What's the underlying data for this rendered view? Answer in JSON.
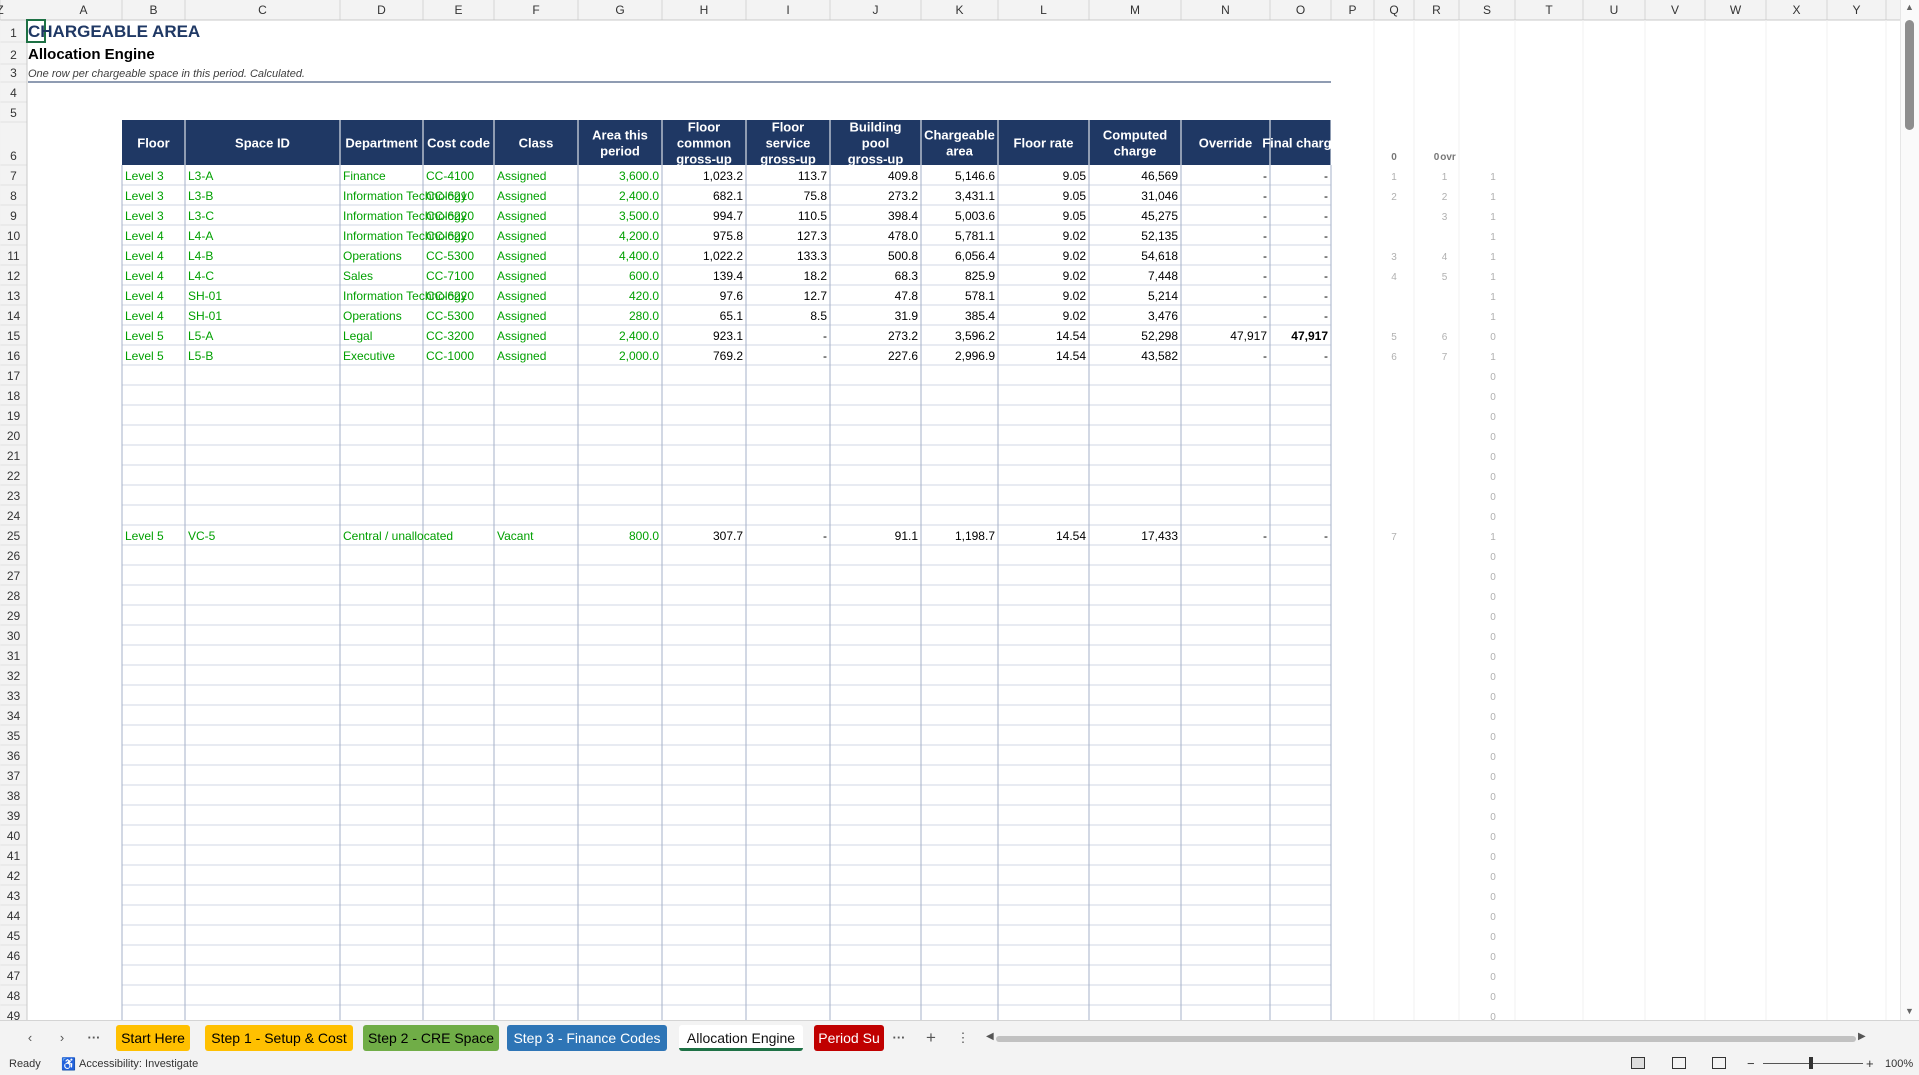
{
  "sheet": {
    "columns": [
      "A",
      "B",
      "C",
      "D",
      "E",
      "F",
      "G",
      "H",
      "I",
      "J",
      "K",
      "L",
      "M",
      "N",
      "O",
      "P",
      "Q",
      "R",
      "S",
      "T",
      "U",
      "V",
      "W",
      "X",
      "Y",
      "Z"
    ],
    "title": "CHARGEABLE AREA",
    "subtitle": "Allocation Engine",
    "note": "One row per chargeable space in this period. Calculated.",
    "headers": [
      [
        "Floor"
      ],
      [
        "Space ID"
      ],
      [
        "Department"
      ],
      [
        "Cost code"
      ],
      [
        "Class"
      ],
      [
        "Area this",
        "period"
      ],
      [
        "Floor",
        "common",
        "gross-up"
      ],
      [
        "Floor",
        "service",
        "gross-up"
      ],
      [
        "Building",
        "pool",
        "gross-up"
      ],
      [
        "Chargeable",
        "area"
      ],
      [
        "Floor rate"
      ],
      [
        "Computed",
        "charge"
      ],
      [
        "Override"
      ],
      [
        "Final charge"
      ]
    ],
    "helper_headers": [
      "0",
      "0",
      "ovr"
    ],
    "rows": [
      {
        "r": 7,
        "cells": [
          "Level 3",
          "L3-A",
          "Finance",
          "CC-4100",
          "Assigned",
          "3,600.0",
          "1,023.2",
          "113.7",
          "409.8",
          "5,146.6",
          "9.05",
          "46,569",
          "-",
          "-"
        ],
        "q": "1",
        "r2": "1",
        "s": "1"
      },
      {
        "r": 8,
        "cells": [
          "Level 3",
          "L3-B",
          "Information Technology",
          "CC-6210",
          "Assigned",
          "2,400.0",
          "682.1",
          "75.8",
          "273.2",
          "3,431.1",
          "9.05",
          "31,046",
          "-",
          "-"
        ],
        "q": "2",
        "r2": "2",
        "s": "1"
      },
      {
        "r": 9,
        "cells": [
          "Level 3",
          "L3-C",
          "Information Technology",
          "CC-6220",
          "Assigned",
          "3,500.0",
          "994.7",
          "110.5",
          "398.4",
          "5,003.6",
          "9.05",
          "45,275",
          "-",
          "-"
        ],
        "q": "",
        "r2": "3",
        "s": "1"
      },
      {
        "r": 10,
        "cells": [
          "Level 4",
          "L4-A",
          "Information Technology",
          "CC-6220",
          "Assigned",
          "4,200.0",
          "975.8",
          "127.3",
          "478.0",
          "5,781.1",
          "9.02",
          "52,135",
          "-",
          "-"
        ],
        "q": "",
        "r2": "",
        "s": "1"
      },
      {
        "r": 11,
        "cells": [
          "Level 4",
          "L4-B",
          "Operations",
          "CC-5300",
          "Assigned",
          "4,400.0",
          "1,022.2",
          "133.3",
          "500.8",
          "6,056.4",
          "9.02",
          "54,618",
          "-",
          "-"
        ],
        "q": "3",
        "r2": "4",
        "s": "1"
      },
      {
        "r": 12,
        "cells": [
          "Level 4",
          "L4-C",
          "Sales",
          "CC-7100",
          "Assigned",
          "600.0",
          "139.4",
          "18.2",
          "68.3",
          "825.9",
          "9.02",
          "7,448",
          "-",
          "-"
        ],
        "q": "4",
        "r2": "5",
        "s": "1"
      },
      {
        "r": 13,
        "cells": [
          "Level 4",
          "SH-01",
          "Information Technology",
          "CC-6220",
          "Assigned",
          "420.0",
          "97.6",
          "12.7",
          "47.8",
          "578.1",
          "9.02",
          "5,214",
          "-",
          "-"
        ],
        "q": "",
        "r2": "",
        "s": "1"
      },
      {
        "r": 14,
        "cells": [
          "Level 4",
          "SH-01",
          "Operations",
          "CC-5300",
          "Assigned",
          "280.0",
          "65.1",
          "8.5",
          "31.9",
          "385.4",
          "9.02",
          "3,476",
          "-",
          "-"
        ],
        "q": "",
        "r2": "",
        "s": "1"
      },
      {
        "r": 15,
        "cells": [
          "Level 5",
          "L5-A",
          "Legal",
          "CC-3200",
          "Assigned",
          "2,400.0",
          "923.1",
          "-",
          "273.2",
          "3,596.2",
          "14.54",
          "52,298",
          "47,917",
          "47,917"
        ],
        "q": "5",
        "r2": "6",
        "s": "0"
      },
      {
        "r": 16,
        "cells": [
          "Level 5",
          "L5-B",
          "Executive",
          "CC-1000",
          "Assigned",
          "2,000.0",
          "769.2",
          "-",
          "227.6",
          "2,996.9",
          "14.54",
          "43,582",
          "-",
          "-"
        ],
        "q": "6",
        "r2": "7",
        "s": "1"
      },
      {
        "r": 25,
        "cells": [
          "Level 5",
          "VC-5",
          "Central / unallocated",
          "",
          "Vacant",
          "800.0",
          "307.7",
          "-",
          "91.1",
          "1,198.7",
          "14.54",
          "17,433",
          "-",
          "-"
        ],
        "q": "7",
        "r2": "",
        "s": "1"
      }
    ],
    "zero_flag": "0",
    "colors": {
      "header_bg": "#1f3864",
      "header_text": "#ffffff",
      "input_green": "#00a000",
      "title": "#1f3864"
    }
  },
  "tabs": {
    "items": [
      {
        "label": "Start Here",
        "bg": "#ffc000",
        "fg": "#000000"
      },
      {
        "label": "Step 1 - Setup & Cost",
        "bg": "#ffc000",
        "fg": "#000000"
      },
      {
        "label": "Step 2 - CRE Space",
        "bg": "#70ad47",
        "fg": "#000000"
      },
      {
        "label": "Step 3 - Finance Codes",
        "bg": "#2e75b6",
        "fg": "#ffffff"
      },
      {
        "label": "Allocation Engine",
        "bg": "#ffffff",
        "fg": "#111111"
      },
      {
        "label": "Period Su",
        "bg": "#c00000",
        "fg": "#ffffff"
      }
    ],
    "more": "···",
    "add": "+",
    "options": "⋮"
  },
  "status": {
    "ready": "Ready",
    "accessibility": "Accessibility: Investigate",
    "zoom": "100%"
  }
}
